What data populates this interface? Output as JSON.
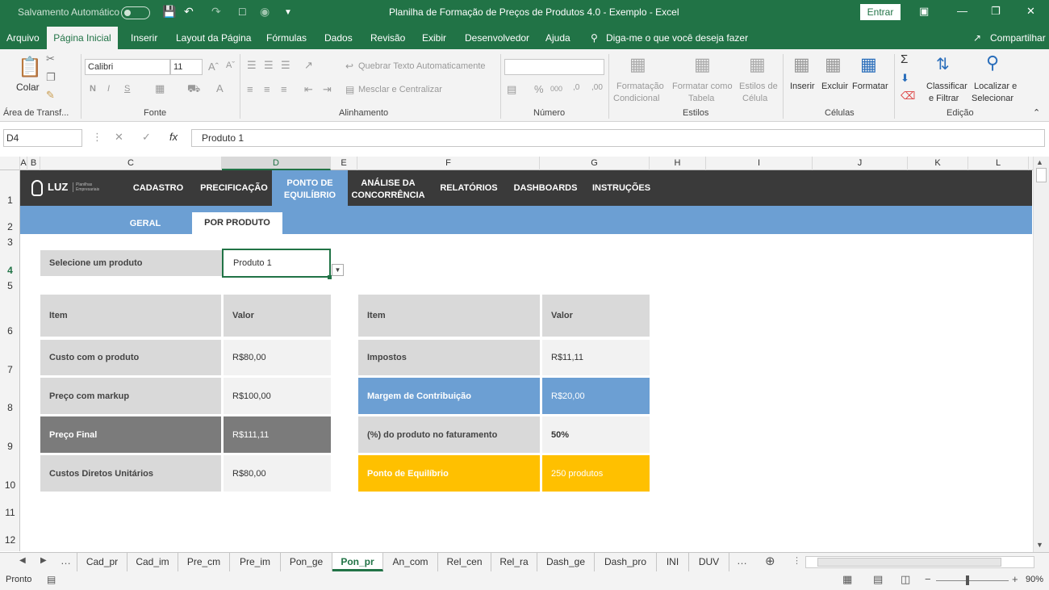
{
  "titlebar": {
    "autosave_label": "Salvamento Automático",
    "title": "Planilha de Formação de Preços de Produtos 4.0 - Exemplo  -  Excel",
    "signin_label": "Entrar"
  },
  "menu": {
    "tabs": [
      "Arquivo",
      "Página Inicial",
      "Inserir",
      "Layout da Página",
      "Fórmulas",
      "Dados",
      "Revisão",
      "Exibir",
      "Desenvolvedor",
      "Ajuda"
    ],
    "tell_me": "Diga-me o que você deseja fazer",
    "share": "Compartilhar"
  },
  "ribbon": {
    "paste": "Colar",
    "clipboard_group": "Área de Transf...",
    "font_name": "Calibri",
    "font_size": "11",
    "font_group": "Fonte",
    "wrap_text": "Quebrar Texto Automaticamente",
    "merge_center": "Mesclar e Centralizar",
    "alignment_group": "Alinhamento",
    "number_group": "Número",
    "cond_format": [
      "Formatação",
      "Condicional"
    ],
    "format_table": [
      "Formatar como",
      "Tabela"
    ],
    "cell_styles": [
      "Estilos de",
      "Célula"
    ],
    "styles_group": "Estilos",
    "insert": "Inserir",
    "delete": "Excluir",
    "format": "Formatar",
    "cells_group": "Células",
    "sort_filter": [
      "Classificar",
      "e Filtrar"
    ],
    "find_select": [
      "Localizar e",
      "Selecionar"
    ],
    "editing_group": "Edição"
  },
  "formula_bar": {
    "name_box": "D4",
    "formula": "Produto 1"
  },
  "grid": {
    "columns": [
      "A",
      "B",
      "C",
      "D",
      "E",
      "F",
      "G",
      "H",
      "I",
      "J",
      "K",
      "L"
    ],
    "rows": [
      "1",
      "2",
      "3",
      "4",
      "5",
      "6",
      "7",
      "8",
      "9",
      "10",
      "11",
      "12"
    ]
  },
  "sheet": {
    "logo": "LUZ",
    "logo_sub": "Planilhas Empresariais",
    "nav": [
      "CADASTRO",
      "PRECIFICAÇÃO",
      "PONTO DE EQUILÍBRIO",
      "ANÁLISE DA CONCORRÊNCIA",
      "RELATÓRIOS",
      "DASHBOARDS",
      "INSTRUÇÕES"
    ],
    "subnav": [
      "GERAL",
      "POR PRODUTO"
    ],
    "select_label": "Selecione um produto",
    "selected_product": "Produto 1",
    "left_table": {
      "header": [
        "Item",
        "Valor"
      ],
      "rows": [
        [
          "Custo com o produto",
          "R$80,00"
        ],
        [
          "Preço com markup",
          "R$100,00"
        ],
        [
          "Preço Final",
          "R$111,11"
        ],
        [
          "Custos Diretos Unitários",
          "R$80,00"
        ]
      ]
    },
    "right_table": {
      "header": [
        "Item",
        "Valor"
      ],
      "rows": [
        [
          "Impostos",
          "R$11,11"
        ],
        [
          "Margem de Contribuição",
          "R$20,00"
        ],
        [
          "(%) do produto no faturamento",
          "50%"
        ],
        [
          "Ponto de Equilíbrio",
          "250 produtos"
        ]
      ]
    }
  },
  "sheet_tabs": [
    "Cad_pr",
    "Cad_im",
    "Pre_cm",
    "Pre_im",
    "Pon_ge",
    "Pon_pr",
    "An_com",
    "Rel_cen",
    "Rel_ra",
    "Dash_ge",
    "Dash_pro",
    "INI",
    "DUV"
  ],
  "active_tab": "Pon_pr",
  "status": {
    "ready": "Pronto",
    "zoom": "90%"
  },
  "colors": {
    "excel_green": "#217346",
    "nav_dark": "#3a3a3a",
    "blue": "#6c9fd3",
    "yellow": "#ffc000",
    "gray": "#7b7b7b"
  }
}
